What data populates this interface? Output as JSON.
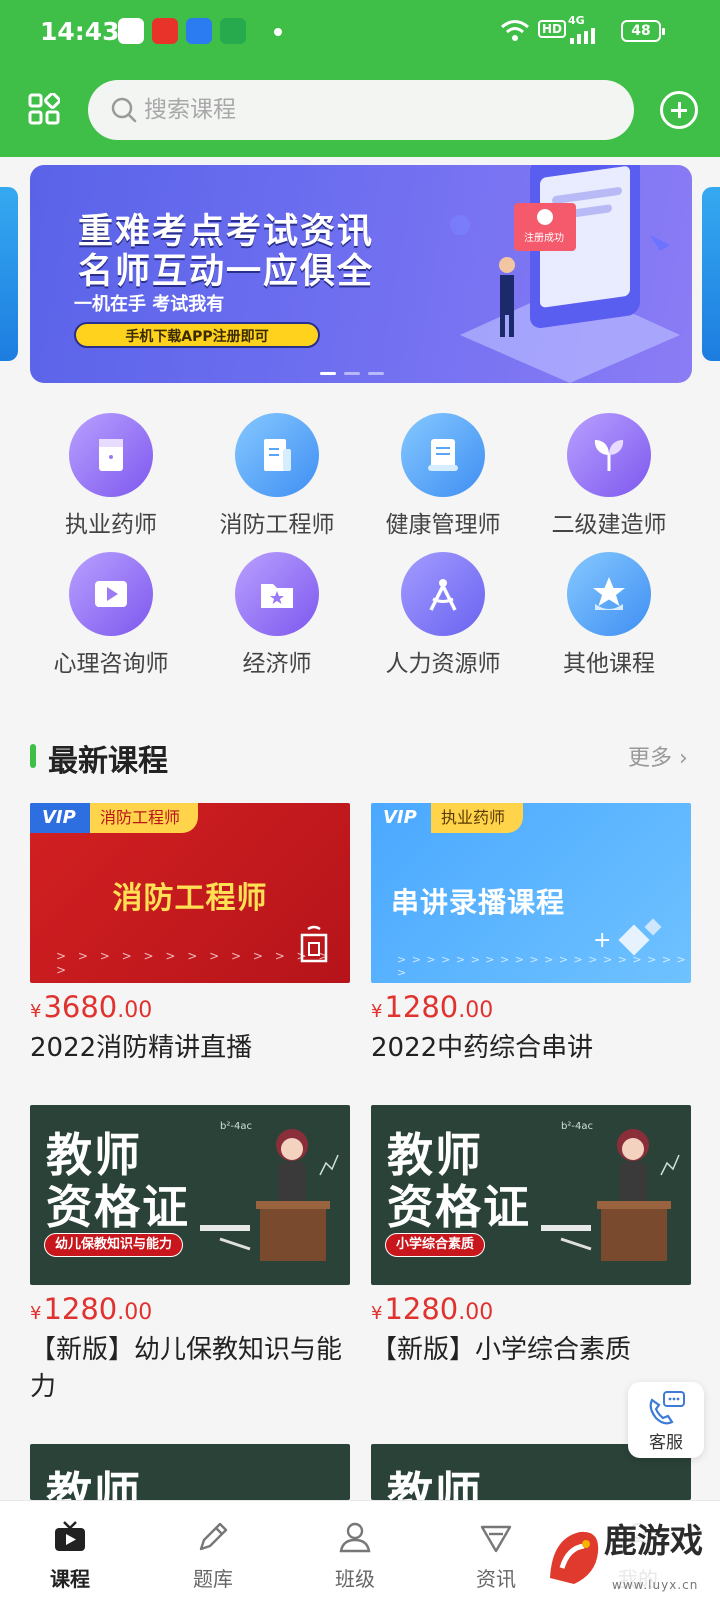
{
  "status_bar": {
    "time": "14:43",
    "network": "HD",
    "signal": "4G",
    "battery": "48"
  },
  "search": {
    "placeholder": "搜索课程"
  },
  "banner": {
    "line1": "重难考点考试资讯",
    "line2": "名师互动一应俱全",
    "subtitle": "一机在手 考试我有",
    "button": "手机下载APP注册即可",
    "badge": "注册成功"
  },
  "categories": [
    {
      "label": "执业药师",
      "icon": "notebook-icon"
    },
    {
      "label": "消防工程师",
      "icon": "document-icon"
    },
    {
      "label": "健康管理师",
      "icon": "scroll-icon"
    },
    {
      "label": "二级建造师",
      "icon": "sprout-icon"
    },
    {
      "label": "心理咨询师",
      "icon": "video-play-icon"
    },
    {
      "label": "经济师",
      "icon": "star-folder-icon"
    },
    {
      "label": "人力资源师",
      "icon": "compass-icon"
    },
    {
      "label": "其他课程",
      "icon": "star-badge-icon"
    }
  ],
  "section": {
    "title": "最新课程",
    "more": "更多"
  },
  "courses": [
    {
      "tag_vip": "VIP",
      "tag": "消防工程师",
      "banner_text": "消防工程师",
      "arrows": "> > > > > > > > > > > > > >",
      "price_int": "3680",
      "price_dec": ".00",
      "title": "2022消防精讲直播"
    },
    {
      "tag_vip": "VIP",
      "tag": "执业药师",
      "banner_text": "串讲录播课程",
      "arrows": "> > > > > > > > > > > > > > > > > > > > >",
      "price_int": "1280",
      "price_dec": ".00",
      "title": "2022中药综合串讲"
    },
    {
      "board_line1": "教师",
      "board_line2": "资格证",
      "pill": "幼儿保教知识与能力",
      "price_int": "1280",
      "price_dec": ".00",
      "title": "【新版】幼儿保教知识与能力"
    },
    {
      "board_line1": "教师",
      "board_line2": "资格证",
      "pill": "小学综合素质",
      "price_int": "1280",
      "price_dec": ".00",
      "title": "【新版】小学综合素质"
    },
    {
      "board_line1": "教师"
    },
    {
      "board_line1": "教师"
    }
  ],
  "currency": "¥",
  "service": {
    "label": "客服"
  },
  "tabs": [
    {
      "label": "课程",
      "icon": "tv-play-icon",
      "active": true
    },
    {
      "label": "题库",
      "icon": "pencil-icon",
      "active": false
    },
    {
      "label": "班级",
      "icon": "users-icon",
      "active": false
    },
    {
      "label": "资讯",
      "icon": "news-icon",
      "active": false
    },
    {
      "label": "我的",
      "icon": "profile-icon",
      "active": false
    }
  ],
  "watermark": {
    "text": "鹿游戏",
    "url": "www.luyx.cn"
  },
  "colors": {
    "primary": "#3fbf47",
    "price": "#e0332f",
    "background": "#f5f5f5"
  }
}
